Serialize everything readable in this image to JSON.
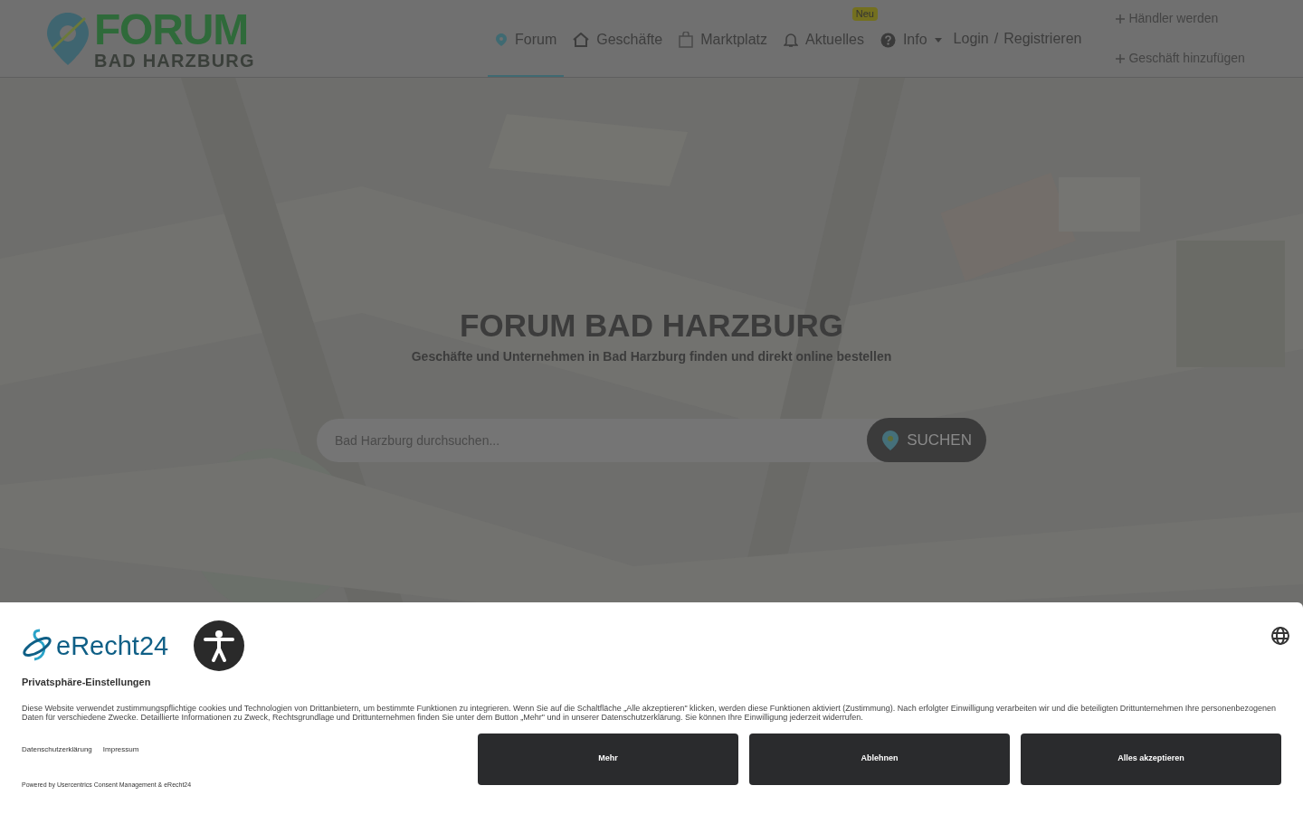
{
  "logo": {
    "title": "FORUM",
    "subtitle": "BAD HARZBURG"
  },
  "nav": [
    {
      "label": "Forum",
      "kind": "pin",
      "selected": true
    },
    {
      "label": "Geschäfte",
      "kind": "shop",
      "selected": false
    },
    {
      "label": "Marktplatz",
      "kind": "bag",
      "selected": false
    },
    {
      "label": "Aktuelles",
      "kind": "bell",
      "selected": false,
      "badge": "Neu"
    },
    {
      "label": "Info",
      "kind": "help",
      "selected": false,
      "dropdown": true
    }
  ],
  "auth": {
    "login": "Login",
    "separator": "/",
    "register": "Registrieren"
  },
  "side_links": [
    "Händler werden",
    "Geschäft hinzufügen"
  ],
  "hero": {
    "title": "FORUM BAD HARZBURG",
    "subtitle": "Geschäfte und Unternehmen in Bad Harzburg finden und direkt online bestellen",
    "search": {
      "placeholder": "Bad Harzburg durchsuchen..."
    },
    "button": "SUCHEN"
  },
  "consent": {
    "brand": "eRecht24",
    "title": "Privatsphäre-Einstellungen",
    "text": "Diese Website verwendet zustimmungspflichtige cookies und Technologien von Drittanbietern, um bestimmte Funktionen zu integrieren. Wenn Sie auf die Schaltfläche „Alle akzeptieren\" klicken, werden diese Funktionen aktiviert (Zustimmung). Nach erfolgter Einwilligung verarbeiten wir und die beteiligten Drittunternehmen Ihre personenbezogenen Daten für verschiedene Zwecke. Detaillierte Informationen zu Zweck, Rechtsgrundlage und Drittunternehmen finden Sie unter dem Button „Mehr\" und in unserer Datenschutzerklärung. Sie können Ihre Einwilligung jederzeit widerrufen.",
    "links": [
      "Datenschutzerklärung",
      "Impressum"
    ],
    "powered": "Powered by Usercentrics Consent Management & eRecht24",
    "buttons": [
      "Mehr",
      "Ablehnen",
      "Alles akzeptieren"
    ]
  }
}
